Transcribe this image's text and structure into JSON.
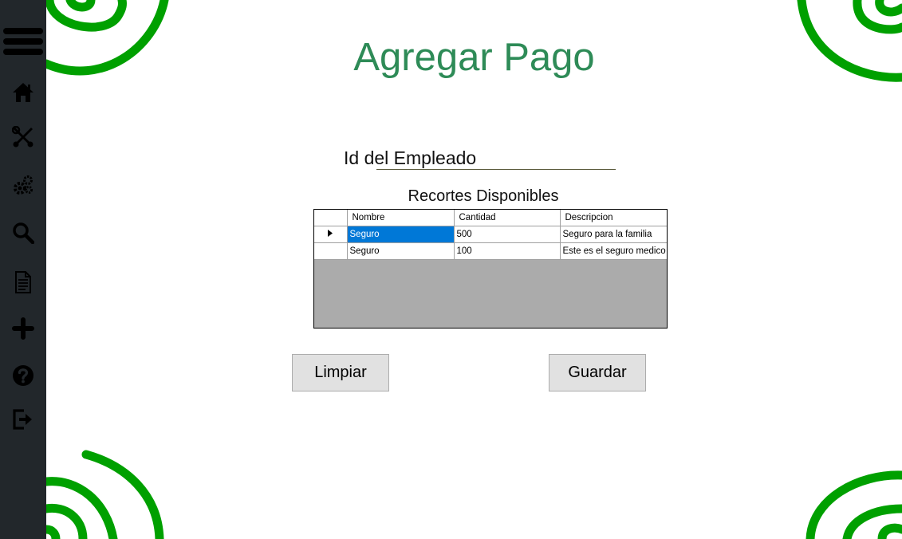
{
  "page": {
    "title": "Agregar Pago"
  },
  "form": {
    "employee_id_label": "Id del Empleado",
    "employee_id_value": ""
  },
  "deductions": {
    "caption": "Recortes Disponibles",
    "columns": [
      "Nombre",
      "Cantidad",
      "Descripcion"
    ],
    "rows": [
      {
        "nombre": "Seguro",
        "cantidad": "500",
        "descripcion": "Seguro para la familia"
      },
      {
        "nombre": "Seguro",
        "cantidad": "100",
        "descripcion": "Este es el seguro medico"
      }
    ]
  },
  "buttons": {
    "clear": "Limpiar",
    "save": "Guardar"
  },
  "sidebar": {
    "icons": [
      "menu-icon",
      "home-icon",
      "tools-icon",
      "gears-icon",
      "search-icon",
      "document-icon",
      "plus-icon",
      "help-icon",
      "logout-icon"
    ]
  },
  "colors": {
    "title": "#2e8b57",
    "spiral": "#00a000",
    "sidebar": "#22272b",
    "selection": "#0078d7"
  }
}
